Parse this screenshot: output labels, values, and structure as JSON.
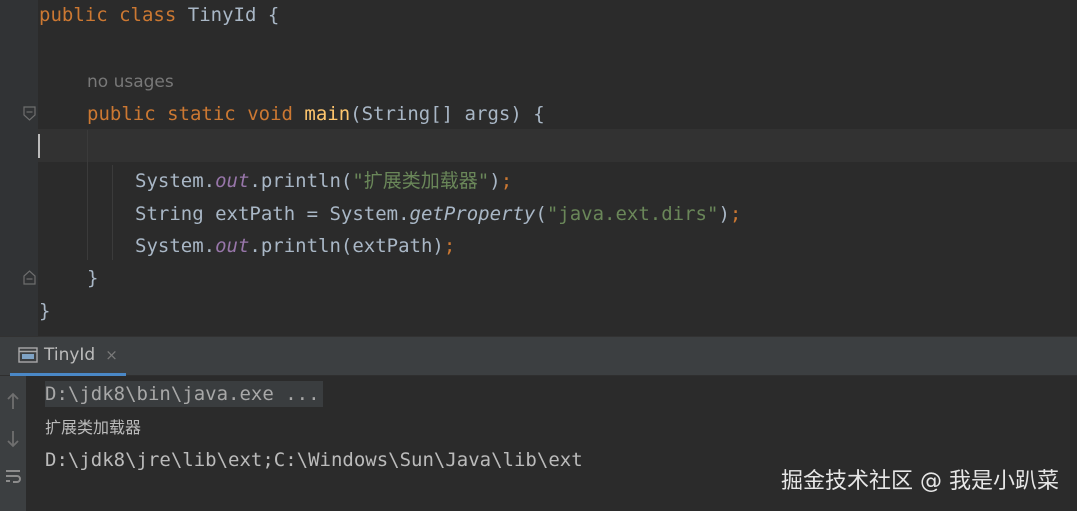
{
  "editor": {
    "lines": {
      "class_decl": {
        "kw1": "public",
        "kw2": "class",
        "name": "TinyId",
        "brace": "{"
      },
      "usage_hint": "no usages",
      "main_decl": {
        "kw1": "public",
        "kw2": "static",
        "kw3": "void",
        "name": "main",
        "params": "(String[] args)",
        "brace": "{"
      },
      "println1": {
        "target": "System.",
        "field": "out",
        "call": ".println(",
        "arg": "\"扩展类加载器\"",
        "close": ")",
        "semi": ";"
      },
      "getprop": {
        "decl": "String extPath = System.",
        "method": "getProperty",
        "open": "(",
        "arg": "\"java.ext.dirs\"",
        "close": ")",
        "semi": ";"
      },
      "println2": {
        "target": "System.",
        "field": "out",
        "call": ".println(extPath)",
        "semi": ";"
      },
      "method_close": "}",
      "class_close": "}"
    }
  },
  "run_panel": {
    "tab_label": "TinyId",
    "close_glyph": "×",
    "console": {
      "command": "D:\\jdk8\\bin\\java.exe ...",
      "output_1": "扩展类加载器",
      "output_2": "D:\\jdk8\\jre\\lib\\ext;C:\\Windows\\Sun\\Java\\lib\\ext"
    },
    "toolbar_icons": [
      "arrow-up-icon",
      "arrow-down-icon",
      "soft-wrap-icon"
    ]
  },
  "watermark": "掘金技术社区 @ 我是小趴菜",
  "colors": {
    "editor_bg": "#2b2b2b",
    "keyword": "#cc7832",
    "method": "#ffc66d",
    "string": "#6a8759",
    "field": "#9876aa",
    "text": "#a9b7c6",
    "tab_underline": "#4a88c7"
  }
}
